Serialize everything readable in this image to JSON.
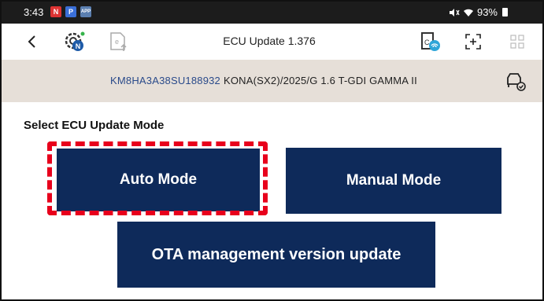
{
  "status_bar": {
    "time": "3:43",
    "notification_icons": [
      "N",
      "P",
      "APP"
    ],
    "battery": "93%"
  },
  "toolbar": {
    "title": "ECU Update 1.376"
  },
  "vehicle": {
    "vin": "KM8HA3A38SU188932",
    "model": "KONA(SX2)/2025/G 1.6 T-GDI GAMMA II"
  },
  "main": {
    "section_title": "Select ECU Update Mode",
    "auto_mode_label": "Auto Mode",
    "manual_mode_label": "Manual Mode",
    "ota_label": "OTA management version update"
  },
  "colors": {
    "button_bg": "#0e2a5a",
    "highlight": "#e8001c",
    "vin_bar": "#e6dfd8"
  }
}
